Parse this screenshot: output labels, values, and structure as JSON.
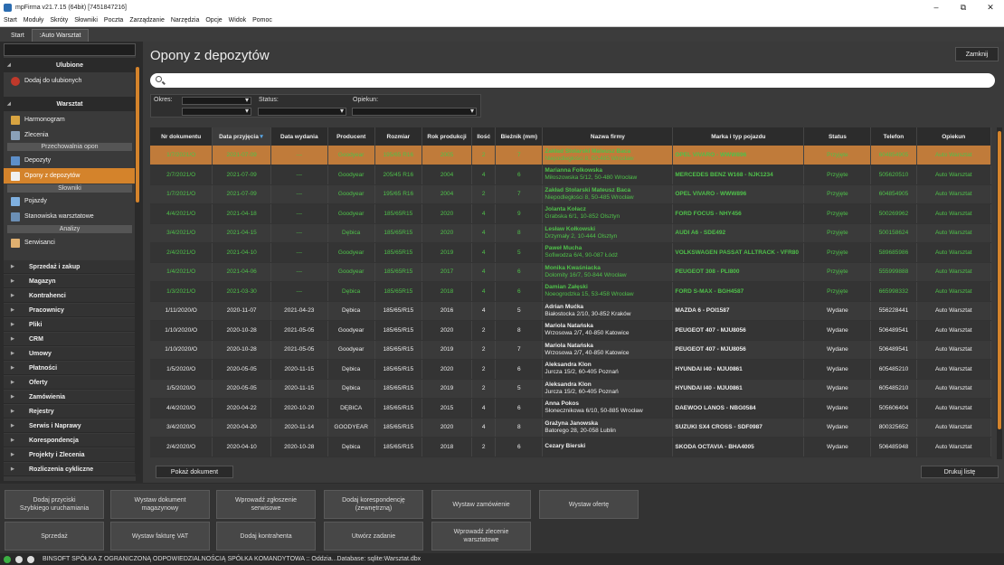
{
  "window": {
    "title": "mpFirma v21.7.15 (64bit) [7451847216]",
    "minimize": "–",
    "maximize": "⧉",
    "close": "✕"
  },
  "menu": [
    "Start",
    "Moduły",
    "Skróty",
    "Słowniki",
    "Poczta",
    "Zarządzanie",
    "Narzędzia",
    "Opcje",
    "Widok",
    "Pomoc"
  ],
  "tabs": [
    "Start",
    ":Auto Warsztat"
  ],
  "sidebar": {
    "ulubione": "Ulubione",
    "dodaj_ulubione": "Dodaj do ulubionych",
    "warsztat": "Warsztat",
    "harmonogram": "Harmonogram",
    "zlecenia": "Zlecenia",
    "przechowalnia": "Przechowalnia opon",
    "depozyty": "Depozyty",
    "opony_depozytow": "Opony z depozytów",
    "slowniki": "Słowniki",
    "pojazdy": "Pojazdy",
    "stanowiska": "Stanowiska warsztatowe",
    "analizy": "Analizy",
    "serwisanci": "Serwisanci",
    "groups": [
      "Sprzedaż i zakup",
      "Magazyn",
      "Kontrahenci",
      "Pracownicy",
      "Pliki",
      "CRM",
      "Umowy",
      "Płatności",
      "Oferty",
      "Zamówienia",
      "Rejestry",
      "Serwis i Naprawy",
      "Korespondencja",
      "Projekty i Zlecenia",
      "Rozliczenia cykliczne"
    ]
  },
  "main": {
    "title": "Opony z depozytów",
    "close_label": "Zamknij",
    "filters": {
      "okres": "Okres:",
      "status": "Status:",
      "opiekun": "Opiekun:"
    },
    "show_doc": "Pokaż dokument",
    "print_list": "Drukuj listę"
  },
  "table": {
    "headers": [
      "Nr dokumentu",
      "Data przyjęcia",
      "Data wydania",
      "Producent",
      "Rozmiar",
      "Rok produkcji",
      "Ilość",
      "Bieżnik (mm)",
      "Nazwa firmy",
      "Marka i typ pojazdu",
      "Status",
      "Telefon",
      "Opiekun"
    ],
    "rows": [
      {
        "cls": "sel",
        "c": [
          "1/7/2021/O",
          "2021-07-09",
          "---",
          "Goodyear",
          "195/65 R16",
          "2005",
          "2",
          "7"
        ],
        "fn": "Zakład Stolarski Mateusz Baca",
        "fa": "Niepodległości 8, 50-485 Wrocław",
        "car": "OPEL VIVARO - WWW896",
        "st": "Przyjęte",
        "tel": "604854905",
        "op": "Auto Warsztat"
      },
      {
        "cls": "g",
        "c": [
          "2/7/2021/O",
          "2021-07-09",
          "---",
          "Goodyear",
          "205/45 R16",
          "2004",
          "4",
          "6"
        ],
        "fn": "Marianna Folkowska",
        "fa": "Miłoszowska 5/12, 50-480 Wrocław",
        "car": "MERCEDES BENZ W168 - NJK1234",
        "st": "Przyjęte",
        "tel": "505620510",
        "op": "Auto Warsztat"
      },
      {
        "cls": "g",
        "c": [
          "1/7/2021/O",
          "2021-07-09",
          "---",
          "Goodyear",
          "195/65 R16",
          "2004",
          "2",
          "7"
        ],
        "fn": "Zakład Stolarski Mateusz Baca",
        "fa": "Niepodległości 8, 50-485 Wrocław",
        "car": "OPEL VIVARO - WWW896",
        "st": "Przyjęte",
        "tel": "604854905",
        "op": "Auto Warsztat"
      },
      {
        "cls": "g",
        "c": [
          "4/4/2021/O",
          "2021-04-18",
          "---",
          "Goodyear",
          "185/65R15",
          "2020",
          "4",
          "9"
        ],
        "fn": "Jolanta Kołacz",
        "fa": "Grabska 6/1, 10-852 Olsztyn",
        "car": "FORD FOCUS - NHY456",
        "st": "Przyjęte",
        "tel": "500269962",
        "op": "Auto Warsztat"
      },
      {
        "cls": "g",
        "c": [
          "3/4/2021/O",
          "2021-04-15",
          "---",
          "Dębica",
          "185/65R15",
          "2020",
          "4",
          "8"
        ],
        "fn": "Lesław Kołkowski",
        "fa": "Drzymały 2, 10-444 Olsztyn",
        "car": "AUDI A6 - SDE492",
        "st": "Przyjęte",
        "tel": "500158624",
        "op": "Auto Warsztat"
      },
      {
        "cls": "g",
        "c": [
          "2/4/2021/O",
          "2021-04-10",
          "---",
          "Goodyear",
          "185/65R15",
          "2019",
          "4",
          "5"
        ],
        "fn": "Paweł Mucha",
        "fa": "Sofiwodza 6/4, 90-087 Łódź",
        "car": "VOLKSWAGEN PASSAT ALLTRACK - VFR80",
        "st": "Przyjęte",
        "tel": "589685986",
        "op": "Auto Warsztat"
      },
      {
        "cls": "g",
        "c": [
          "1/4/2021/O",
          "2021-04-06",
          "---",
          "Goodyear",
          "185/65R15",
          "2017",
          "4",
          "6"
        ],
        "fn": "Monika Kwaśniacka",
        "fa": "Dolomity 16/7, 50-844 Wrocław",
        "car": "PEUGEOT 308 - PLI800",
        "st": "Przyjęte",
        "tel": "555999888",
        "op": "Auto Warsztat"
      },
      {
        "cls": "g",
        "c": [
          "1/3/2021/O",
          "2021-03-30",
          "---",
          "Dębica",
          "185/65R15",
          "2018",
          "4",
          "6"
        ],
        "fn": "Damian Załęski",
        "fa": "Noeogrodzka 15, 53-458 Wrocław",
        "car": "FORD S-MAX - BGH4587",
        "st": "Przyjęte",
        "tel": "665998332",
        "op": "Auto Warsztat"
      },
      {
        "cls": "w",
        "c": [
          "1/11/2020/O",
          "2020-11-07",
          "2021-04-23",
          "Dębica",
          "185/65/R15",
          "2016",
          "4",
          "5"
        ],
        "fn": "Adrian Mućka",
        "fa": "Białostocka 2/10, 30-852 Kraków",
        "car": "MAZDA 6 - POI1587",
        "st": "Wydane",
        "tel": "556228441",
        "op": "Auto Warsztat"
      },
      {
        "cls": "w",
        "c": [
          "1/10/2020/O",
          "2020-10-28",
          "2021-05-05",
          "Goodyear",
          "185/65/R15",
          "2020",
          "2",
          "8"
        ],
        "fn": "Mariola Natańska",
        "fa": "Wrzosowa 2/7, 40-850 Katowice",
        "car": "PEUGEOT 407 - MJU8056",
        "st": "Wydane",
        "tel": "506489541",
        "op": "Auto Warsztat"
      },
      {
        "cls": "w",
        "c": [
          "1/10/2020/O",
          "2020-10-28",
          "2021-05-05",
          "Goodyear",
          "185/65/R15",
          "2019",
          "2",
          "7"
        ],
        "fn": "Mariola Natańska",
        "fa": "Wrzosowa 2/7, 40-850 Katowice",
        "car": "PEUGEOT 407 - MJU8056",
        "st": "Wydane",
        "tel": "506489541",
        "op": "Auto Warsztat"
      },
      {
        "cls": "w",
        "c": [
          "1/5/2020/O",
          "2020-05-05",
          "2020-11-15",
          "Dębica",
          "185/65/R15",
          "2020",
          "2",
          "6"
        ],
        "fn": "Aleksandra Klon",
        "fa": "Jurcza 15/2, 60-405 Poznań",
        "car": "HYUNDAI I40 - MJU0861",
        "st": "Wydane",
        "tel": "605485210",
        "op": "Auto Warsztat"
      },
      {
        "cls": "w",
        "c": [
          "1/5/2020/O",
          "2020-05-05",
          "2020-11-15",
          "Dębica",
          "185/65/R15",
          "2019",
          "2",
          "5"
        ],
        "fn": "Aleksandra Klon",
        "fa": "Jurcza 15/2, 60-405 Poznań",
        "car": "HYUNDAI I40 - MJU0861",
        "st": "Wydane",
        "tel": "605485210",
        "op": "Auto Warsztat"
      },
      {
        "cls": "w",
        "c": [
          "4/4/2020/O",
          "2020-04-22",
          "2020-10-20",
          "DĘBICA",
          "185/65/R15",
          "2015",
          "4",
          "6"
        ],
        "fn": "Anna Pokos",
        "fa": "Słonecznikowa 6/10, 50-885 Wrocław",
        "car": "DAEWOO LANOS - NBG0584",
        "st": "Wydane",
        "tel": "505606404",
        "op": "Auto Warsztat"
      },
      {
        "cls": "w",
        "c": [
          "3/4/2020/O",
          "2020-04-20",
          "2020-11-14",
          "GOODYEAR",
          "185/65/R15",
          "2020",
          "4",
          "8"
        ],
        "fn": "Grażyna Janowska",
        "fa": "Batorego 28, 20-058 Lublin",
        "car": "SUZUKI SX4 CROSS - SDF0987",
        "st": "Wydane",
        "tel": "800325652",
        "op": "Auto Warsztat"
      },
      {
        "cls": "w",
        "c": [
          "2/4/2020/O",
          "2020-04-10",
          "2020-10-28",
          "Dębica",
          "185/65/R15",
          "2018",
          "2",
          "6"
        ],
        "fn": "Cezary Bierski",
        "fa": "",
        "car": "SKODA OCTAVIA - BHA4005",
        "st": "Wydane",
        "tel": "506485948",
        "op": "Auto Warsztat"
      }
    ]
  },
  "actions": [
    "Dodaj przyciski\nSzybkiego uruchamiania",
    "Wystaw dokument\nmagazynowy",
    "Wprowadź zgłoszenie\nserwisowe",
    "Dodaj korespondencję\n(zewnętrzną)",
    "Wystaw zamówienie",
    "Wystaw ofertę",
    "Sprzedaż",
    "Wystaw fakturę VAT",
    "Dodaj kontrahenta",
    "Utwórz zadanie",
    "Wprowadź zlecenie\nwarsztatowe"
  ],
  "status": "BINSOFT SPÓŁKA Z OGRANICZONĄ ODPOWIEDZIALNOŚCIĄ SPÓŁKA KOMANDYTOWA :: Oddzia...Database: sqlite:Warsztat.dbx",
  "colors": {
    "accent": "#d4832b",
    "green_text": "#4fc14a"
  }
}
